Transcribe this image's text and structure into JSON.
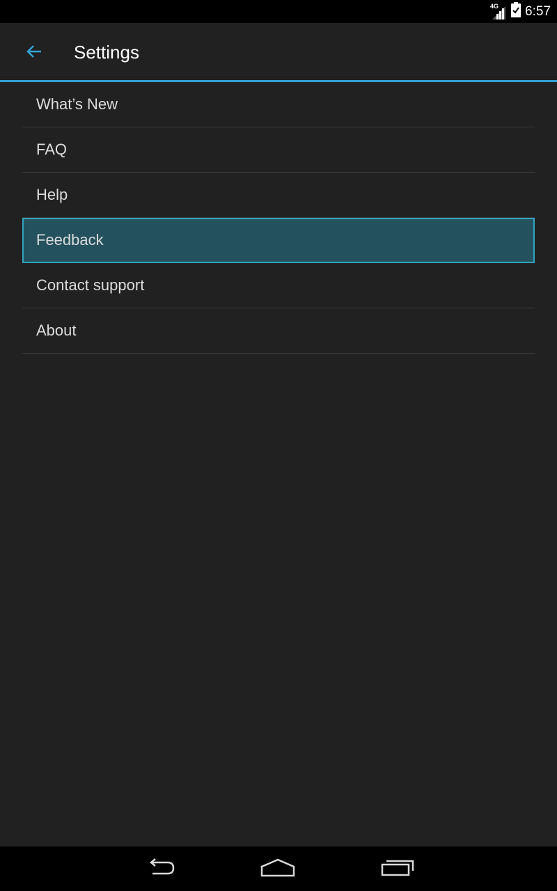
{
  "status_bar": {
    "network_type": "4G",
    "time": "6:57",
    "icons": [
      "signal-icon",
      "battery-icon"
    ]
  },
  "action_bar": {
    "back_icon": "back-arrow-icon",
    "title": "Settings",
    "accent_color": "#33a1d6"
  },
  "settings_list": {
    "items": [
      {
        "label": "What’s New",
        "selected": false
      },
      {
        "label": "FAQ",
        "selected": false
      },
      {
        "label": "Help",
        "selected": false
      },
      {
        "label": "Feedback",
        "selected": true
      },
      {
        "label": "Contact support",
        "selected": false
      },
      {
        "label": "About",
        "selected": false
      }
    ]
  },
  "nav_bar": {
    "icons": [
      "back-icon",
      "home-icon",
      "recent-apps-icon"
    ]
  },
  "colors": {
    "background": "#212121",
    "selected_fill": "#24515e",
    "selected_border": "#33a1c0",
    "text": "#dcdcdc"
  }
}
